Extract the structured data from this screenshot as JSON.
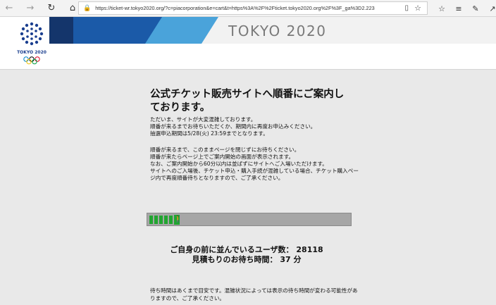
{
  "browser": {
    "url": "https://ticket-wr.tokyo2020.org/?c=piacorporation&e=cart&t=https%3A%2F%2Fticket.tokyo2020.org%2F%3F_ga%3D2.223",
    "back_icon": "arrow-left",
    "forward_icon": "arrow-right",
    "refresh_icon": "refresh",
    "home_icon": "home"
  },
  "header": {
    "logo_text": "TOKYO 2020",
    "title": "TOKYO 2020",
    "colors": {
      "navy": "#14356b",
      "blue": "#1b5aa8",
      "mid_blue": "#2f86c7",
      "light_blue": "#4aa3da"
    }
  },
  "main": {
    "heading": "公式チケット販売サイトへ順番にご案内しております。",
    "paragraph1": [
      "ただいま、サイトが大変混雑しております。",
      "順番が来るまでお待ちいただくか、期間内に再度お申込みください。",
      "抽選申込期間は5/28(火) 23:59までとなります。"
    ],
    "paragraph2": [
      "順番が来るまで、このままページを閉じずにお待ちください。",
      "順番が来たらページ上でご案内開始の画面が表示されます。",
      "なお、ご案内開始から60分以内は並ばずにサイトへご入場いただけます。",
      "サイトへのご入場後、チケット申込・購入手続が混雑している場合、チケット購入ページ内で再度順番待ちとなりますので、ご了承ください。"
    ],
    "progress_percent": 16,
    "progress_color": "#22a531",
    "queue_label": "ご自身の前に並んでいるユーザ数：",
    "queue_count": "28118",
    "wait_label": "見積もりのお待ち時間：",
    "wait_value": "37 分",
    "note": "待ち時間はあくまで目安です。混雑状況によっては表示の待ち時間が変わる可能性がありますので、ご了承ください。"
  }
}
